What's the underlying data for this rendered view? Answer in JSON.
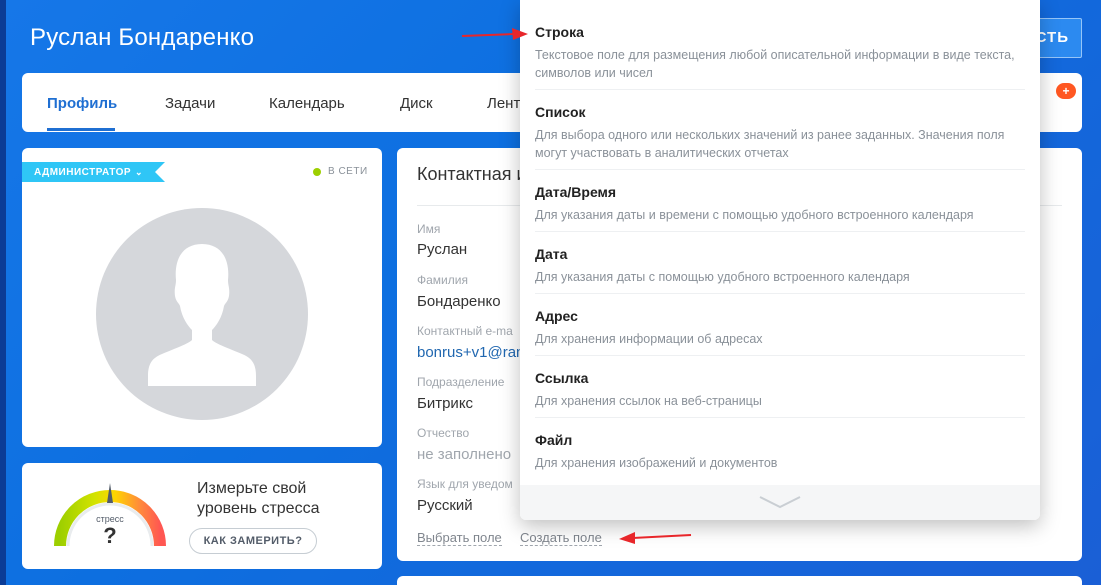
{
  "header": {
    "user_name": "Руслан Бондаренко",
    "action_button_label": "СТЬ"
  },
  "tabs": [
    {
      "label": "Профиль",
      "active": true
    },
    {
      "label": "Задачи"
    },
    {
      "label": "Календарь"
    },
    {
      "label": "Диск"
    },
    {
      "label": "Лент"
    }
  ],
  "tab_counter": "+",
  "profile": {
    "role_badge": "АДМИНИСТРАТОР",
    "status": "В СЕТИ",
    "status_color": "#9dcf00"
  },
  "stress": {
    "gauge_label": "стресс",
    "gauge_value": "?",
    "prompt": "Измерьте свой уровень стресса",
    "button_label": "КАК ЗАМЕРИТЬ?"
  },
  "contact": {
    "title": "Контактная и",
    "fields": [
      {
        "label": "Имя",
        "value": "Руслан"
      },
      {
        "label": "Фамилия",
        "value": "Бондаренко"
      },
      {
        "label": "Контактный e-ma",
        "value": "bonrus+v1@ran"
      },
      {
        "label": "Подразделение",
        "value": "Битрикс"
      },
      {
        "label": "Отчество",
        "value": "не заполнено"
      },
      {
        "label": "Язык для уведом",
        "value": "Русский"
      }
    ],
    "select_field_link": "Выбрать поле",
    "create_field_link": "Создать поле"
  },
  "field_types": [
    {
      "title": "Строка",
      "description": "Текстовое поле для размещения любой описательной информации в виде текста, символов или чисел"
    },
    {
      "title": "Список",
      "description": "Для выбора одного или нескольких значений из ранее заданных. Значения поля могут участвовать в аналитических отчетах"
    },
    {
      "title": "Дата/Время",
      "description": "Для указания даты и времени с помощью удобного встроенного календаря"
    },
    {
      "title": "Дата",
      "description": "Для указания даты с помощью удобного встроенного календаря"
    },
    {
      "title": "Адрес",
      "description": "Для хранения информации об адресах"
    },
    {
      "title": "Ссылка",
      "description": "Для хранения ссылок на веб-страницы"
    },
    {
      "title": "Файл",
      "description": "Для хранения изображений и документов"
    }
  ],
  "icons": {
    "avatar": "user-silhouette-icon",
    "expand": "chevron-down-icon",
    "arrow": "red-arrow-icon"
  },
  "colors": {
    "accent": "#1f6fd2",
    "badge": "#2fc6f6",
    "arrow": "#e8262a"
  }
}
